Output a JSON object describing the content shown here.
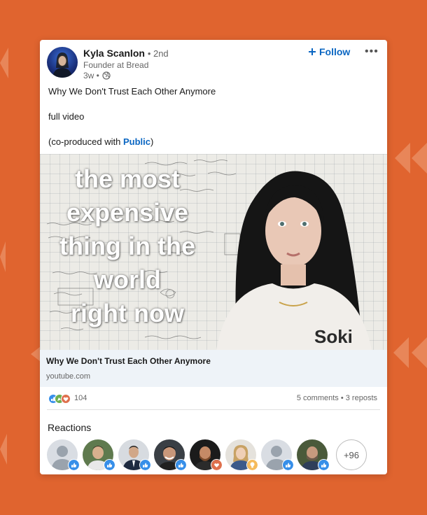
{
  "post": {
    "author_name": "Kyla Scanlon",
    "connection_degree": "• 2nd",
    "author_headline": "Founder at Bread",
    "time_ago": "3w •",
    "follow_label": "Follow",
    "more_label": "•••",
    "text_line1": "Why We Don't Trust Each Other Anymore",
    "text_line2": "full video",
    "text_line3_prefix": "(co-produced with ",
    "text_line3_link": "Public",
    "text_line3_suffix": ")"
  },
  "video": {
    "overlay_lines": [
      "the most",
      "expensive",
      "thing in the",
      "world",
      "right now"
    ]
  },
  "link_preview": {
    "title": "Why We Don't Trust Each Other Anymore",
    "domain": "youtube.com"
  },
  "social": {
    "reaction_count": "104",
    "comments_reposts": "5 comments • 3 reposts"
  },
  "reactions": {
    "title": "Reactions",
    "more_count": "+96",
    "avatars": [
      "person-1",
      "person-2",
      "person-3",
      "person-4",
      "person-5",
      "person-6",
      "person-7",
      "person-8"
    ]
  },
  "colors": {
    "background": "#e0642f",
    "accent": "#0a66c2",
    "like": "#378fe9",
    "love": "#df704d",
    "insightful": "#f5bb5c"
  },
  "icons": [
    "globe-icon",
    "plus-icon",
    "more-icon",
    "like-icon",
    "celebrate-icon",
    "love-icon",
    "insightful-icon"
  ]
}
